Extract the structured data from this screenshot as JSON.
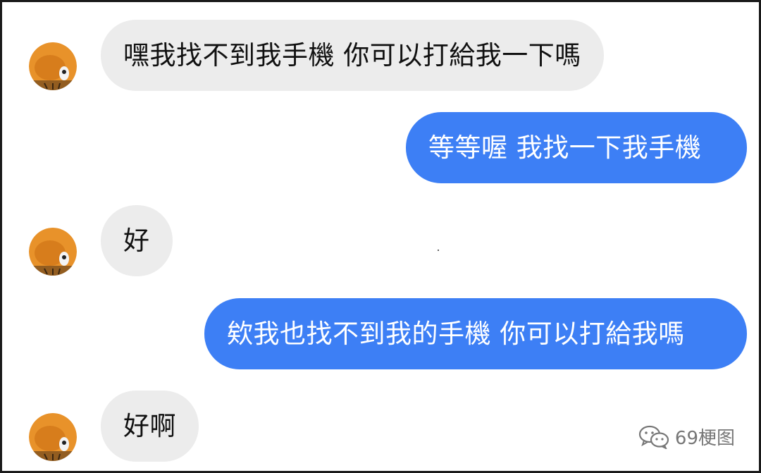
{
  "conversation": {
    "messages": [
      {
        "side": "in",
        "text": "嘿我找不到我手機 你可以打給我一下嗎"
      },
      {
        "side": "out",
        "text": "等等喔 我找一下我手機"
      },
      {
        "side": "in",
        "text": "好"
      },
      {
        "side": "out",
        "text": "欸我也找不到我的手機 你可以打給我嗎"
      },
      {
        "side": "in",
        "text": "好啊"
      }
    ]
  },
  "watermark": {
    "text": "69梗图",
    "icon": "wechat-icon"
  },
  "colors": {
    "incoming_bubble": "#ececec",
    "outgoing_bubble": "#3d7ff5",
    "avatar_orange": "#e8922a"
  }
}
